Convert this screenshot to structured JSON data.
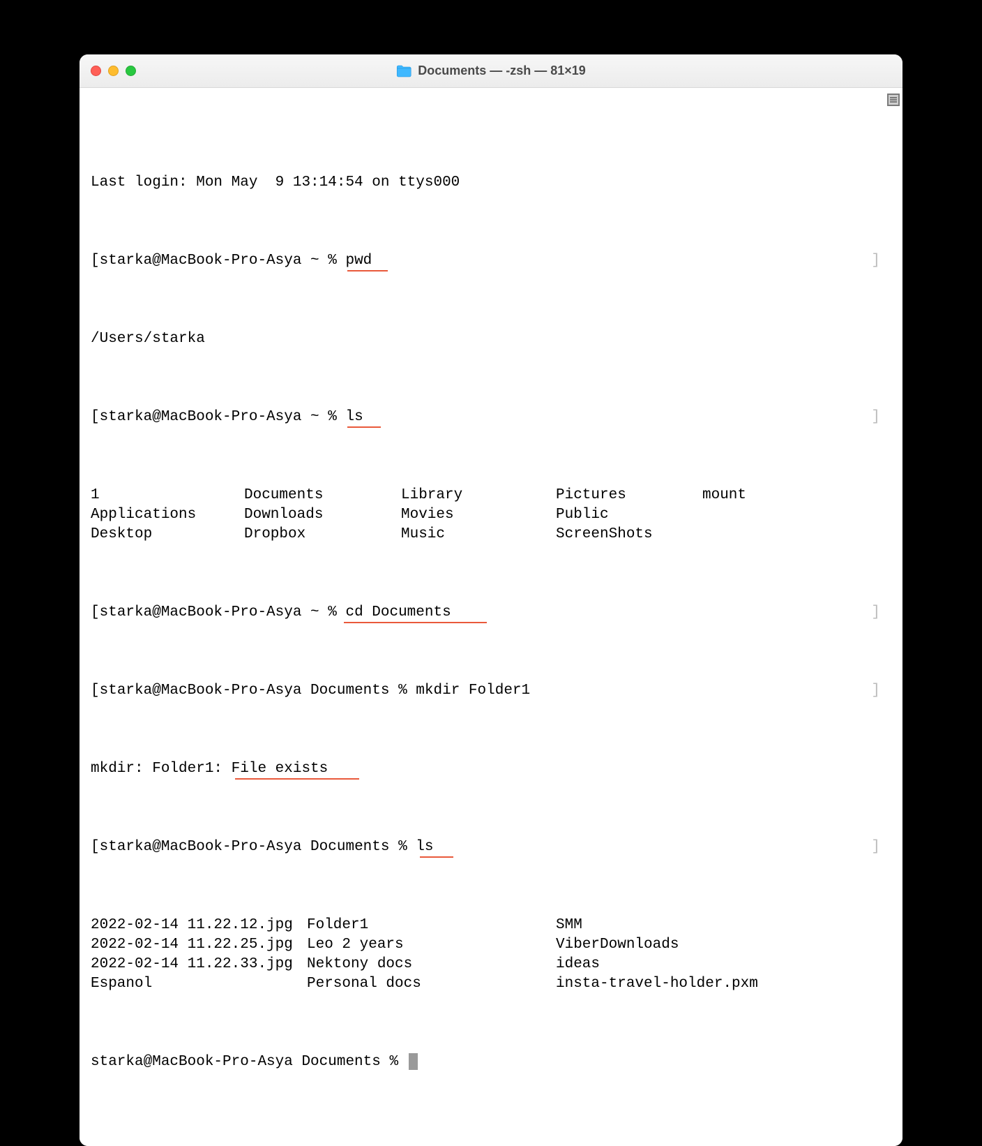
{
  "titlebar": {
    "title": "Documents — -zsh — 81×19"
  },
  "terminal": {
    "last_login": "Last login: Mon May  9 13:14:54 on ttys000",
    "prompts": {
      "p1_left": "[",
      "p1_text": "starka@MacBook-Pro-Asya ~ % ",
      "p1_cmd": "pwd",
      "p1_right": "]",
      "pwd_out": "/Users/starka",
      "p2_text": "starka@MacBook-Pro-Asya ~ % ",
      "p2_cmd": "ls",
      "p3_text": "starka@MacBook-Pro-Asya ~ % ",
      "p3_cmd": "cd Documents",
      "p4_text": "starka@MacBook-Pro-Asya Documents % ",
      "p4_cmd": "mkdir Folder1",
      "mkdir_err": "mkdir: Folder1: File exists",
      "p5_text": "starka@MacBook-Pro-Asya Documents % ",
      "p5_cmd": "ls",
      "p6_text": "starka@MacBook-Pro-Asya Documents % "
    },
    "ls_home": {
      "columns": [
        "1",
        "Documents",
        "Library",
        "Pictures",
        "mount",
        "Applications",
        "Downloads",
        "Movies",
        "Public",
        "",
        "Desktop",
        "Dropbox",
        "Music",
        "ScreenShots",
        ""
      ]
    },
    "ls_docs": {
      "columns": [
        "2022-02-14 11.22.12.jpg",
        "Folder1",
        "SMM",
        "2022-02-14 11.22.25.jpg",
        "Leo 2 years",
        "ViberDownloads",
        "2022-02-14 11.22.33.jpg",
        "Nektony docs",
        "ideas",
        "Espanol",
        "Personal docs",
        "insta-travel-holder.pxm"
      ]
    }
  },
  "underlines": [
    {
      "text": "pwd"
    },
    {
      "text": "ls"
    },
    {
      "text": "cd Documents"
    },
    {
      "text": "File exists"
    },
    {
      "text": "ls"
    }
  ]
}
